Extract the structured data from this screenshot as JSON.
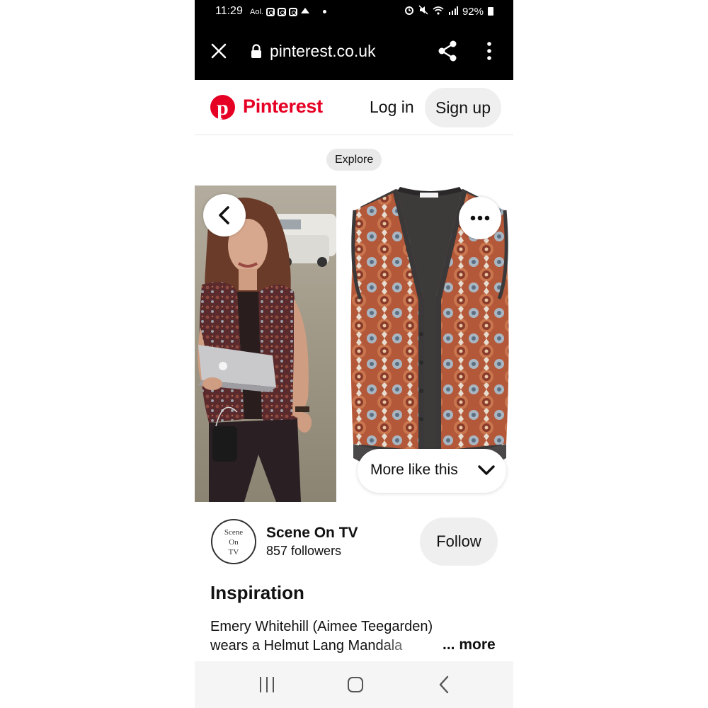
{
  "status_bar": {
    "time": "11:29",
    "aol": "Aol.",
    "battery": "92%"
  },
  "browser": {
    "url": "pinterest.co.uk"
  },
  "header": {
    "brand": "Pinterest",
    "login_label": "Log in",
    "signup_label": "Sign up",
    "brand_color": "#e60023"
  },
  "explore_label": "Explore",
  "more_like_this_label": "More like this",
  "profile": {
    "avatar_text": [
      "Scene",
      "On",
      "TV"
    ],
    "name": "Scene On TV",
    "followers": "857 followers",
    "follow_label": "Follow"
  },
  "pin": {
    "heading": "Inspiration",
    "description_line1": "Emery Whitehill (Aimee Teegarden)",
    "description_line2": "wears a Helmut Lang Mandala",
    "more_label": "... more"
  }
}
